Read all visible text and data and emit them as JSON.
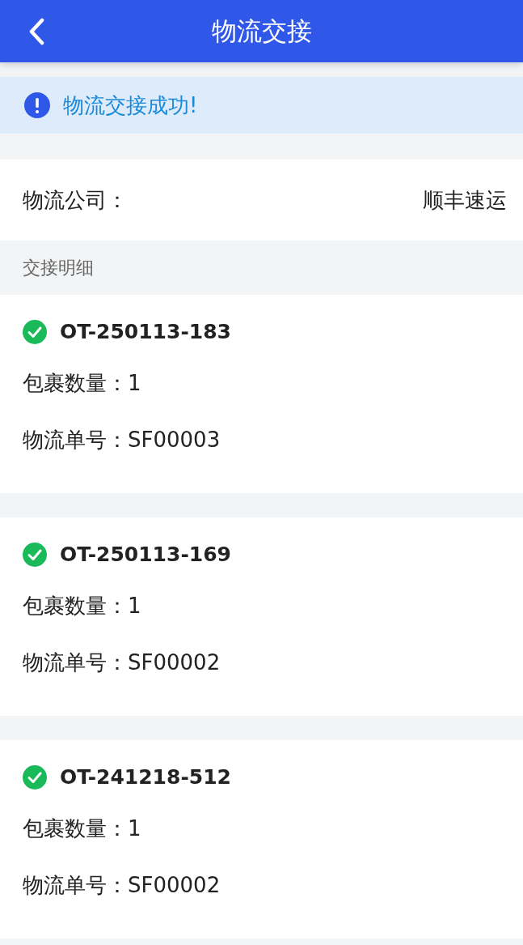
{
  "header": {
    "title": "物流交接"
  },
  "alert": {
    "message": "物流交接成功!"
  },
  "company": {
    "label": "物流公司：",
    "value": "顺丰速运"
  },
  "section": {
    "label": "交接明细"
  },
  "orders": [
    {
      "id": "OT-250113-183",
      "done": true,
      "fields": [
        {
          "label": "包裹数量：",
          "value": "1"
        },
        {
          "label": "物流单号：",
          "value": "SF00003"
        }
      ]
    },
    {
      "id": "OT-250113-169",
      "done": true,
      "fields": [
        {
          "label": "包裹数量：",
          "value": "1"
        },
        {
          "label": "物流单号：",
          "value": "SF00002"
        }
      ]
    },
    {
      "id": "OT-241218-512",
      "done": true,
      "fields": [
        {
          "label": "包裹数量：",
          "value": "1"
        },
        {
          "label": "物流单号：",
          "value": "SF00002"
        }
      ]
    }
  ]
}
